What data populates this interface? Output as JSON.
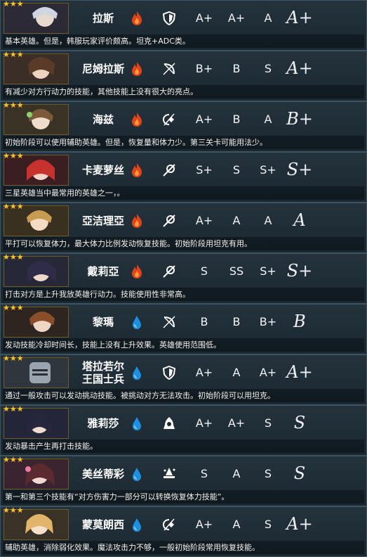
{
  "colors": {
    "fire": "#e2441a",
    "water": "#1d8fe0",
    "star": "#f3c33a"
  },
  "heroes": [
    {
      "stars": 3,
      "name": "拉斯",
      "element": "fire",
      "role_icon": "shield-icon",
      "grades": [
        "A+",
        "A+",
        "A"
      ],
      "overall": "A+",
      "desc": "基本英雄。但是，韩服玩家评价颇高。坦克+ADC类。"
    },
    {
      "stars": 3,
      "name": "尼姆拉斯",
      "element": "fire",
      "role_icon": "bow-icon",
      "grades": [
        "B+",
        "B",
        "S"
      ],
      "overall": "A+",
      "desc": "有减少对方行动力的技能，其他技能上没有很大的亮点。"
    },
    {
      "stars": 3,
      "name": "海兹",
      "element": "fire",
      "role_icon": "support-icon",
      "grades": [
        "A+",
        "B",
        "A"
      ],
      "overall": "B+",
      "desc": "初始阶段可以使用辅助英雄。但是，恢复量和体力少。第三关卡可能用法少。"
    },
    {
      "stars": 3,
      "name": "卡麦萝丝",
      "element": "fire",
      "role_icon": "staff-icon",
      "grades": [
        "S+",
        "S",
        "S+"
      ],
      "overall": "S+",
      "desc": "三星英雄当中最常用的英雄之一，。"
    },
    {
      "stars": 3,
      "name": "亞洁理亞",
      "element": "fire",
      "role_icon": "staff-icon",
      "grades": [
        "A+",
        "A",
        "A"
      ],
      "overall": "A",
      "desc": "平打可以恢复体力，最大体力比例发动恢复技能。初始阶段用坦克有用。"
    },
    {
      "stars": 3,
      "name": "戴莉亞",
      "element": "fire",
      "role_icon": "staff-icon",
      "grades": [
        "S",
        "SS",
        "S+"
      ],
      "overall": "S+",
      "desc": "打击对方是上升我放英雄行动力。技能使用性非常高。"
    },
    {
      "stars": 3,
      "name": "黎瑪",
      "element": "water",
      "role_icon": "bow-icon",
      "grades": [
        "B",
        "B",
        "B+"
      ],
      "overall": "B",
      "desc": "发动技能冷却时间长，技能上没有上升效果。英雄使用范围低。"
    },
    {
      "stars": 3,
      "name": "塔拉若尔\n王国士兵",
      "element": "water",
      "role_icon": "shield-icon",
      "grades": [
        "A+",
        "A",
        "A+"
      ],
      "overall": "A+",
      "desc": "通过一般攻击可以发动挑动技能。被挑动对方无法攻击。初始阶段可以用坦克。"
    },
    {
      "stars": 3,
      "name": "雅莉莎",
      "element": "water",
      "role_icon": "assassin-icon",
      "grades": [
        "A+",
        "A+",
        "S"
      ],
      "overall": "S",
      "desc": "发动暴击产生再打击技能。"
    },
    {
      "stars": 3,
      "name": "美丝蒂彩",
      "element": "water",
      "role_icon": "mage-icon",
      "grades": [
        "S",
        "A",
        "S"
      ],
      "overall": "S",
      "desc": "第一和第三个技能有“对方伤害力一部分可以转换恢复体力技能”。"
    },
    {
      "stars": 3,
      "name": "蒙莫朗西",
      "element": "water",
      "role_icon": "support-icon",
      "grades": [
        "A+",
        "A",
        "S"
      ],
      "overall": "A+",
      "desc": "辅助英雄，消除弱化效果。魔法攻击力不够，一般初始阶段常用恢复技能。"
    }
  ]
}
